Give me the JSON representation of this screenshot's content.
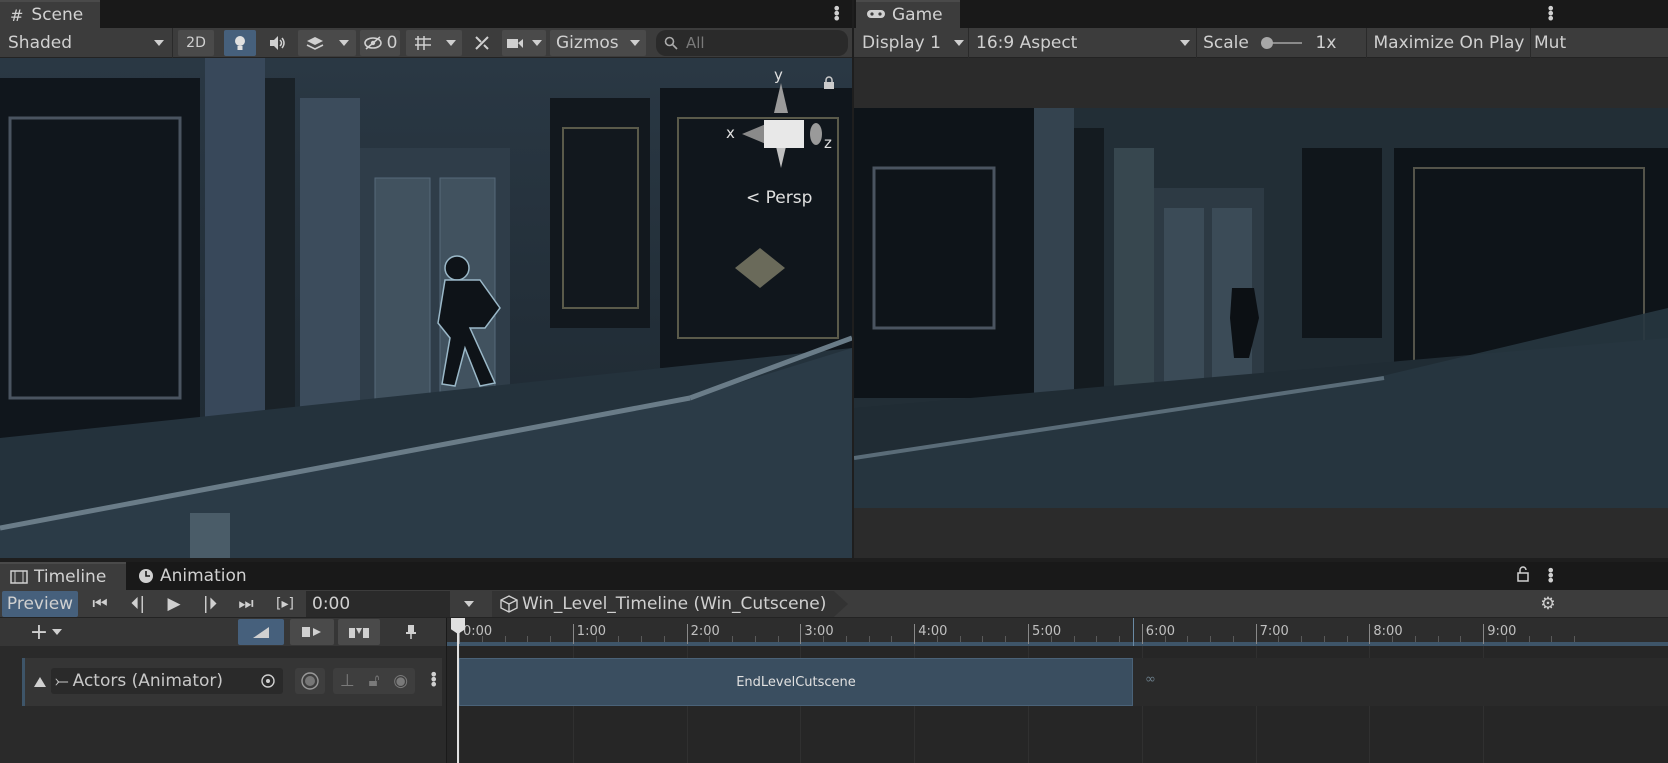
{
  "scene": {
    "tab_label": "Scene",
    "shading_mode": "Shaded",
    "mode_2d": "2D",
    "hidden_count": "0",
    "gizmos_label": "Gizmos",
    "search_placeholder": "All",
    "gizmo_axes": {
      "x": "x",
      "y": "y",
      "z": "z"
    },
    "projection_label": "Persp"
  },
  "game": {
    "tab_label": "Game",
    "display": "Display 1",
    "aspect": "16:9 Aspect",
    "scale_label": "Scale",
    "scale_value": "1x",
    "maximize_label": "Maximize On Play",
    "mute_label": "Mut"
  },
  "timeline": {
    "tab_label": "Timeline",
    "animation_tab_label": "Animation",
    "preview_label": "Preview",
    "current_time": "0:00",
    "asset_name": "Win_Level_Timeline (Win_Cutscene)",
    "ruler_ticks": [
      "0:00",
      "1:00",
      "2:00",
      "3:00",
      "4:00",
      "5:00",
      "6:00",
      "7:00",
      "8:00",
      "9:00"
    ],
    "tracks": [
      {
        "name": "Actors (Animator)",
        "clip": "EndLevelCutscene"
      }
    ]
  },
  "colors": {
    "accent": "#46607c",
    "clip": "#3a4e60",
    "panel": "#3c3c3c",
    "background": "#1e1e1e"
  }
}
